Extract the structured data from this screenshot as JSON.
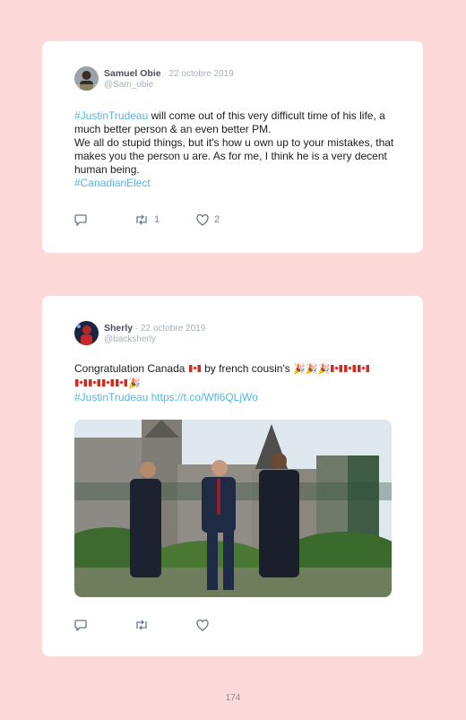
{
  "tweets": [
    {
      "name": "Samuel Obie",
      "date": " · 22 octobre 2019",
      "handle": "@Sam_obie",
      "hashtag1": "#JustinTrudeau",
      "line1_rest": " will come out of this very difficult time of his life, a much better person & an even better PM.",
      "line2": "We all do stupid things, but it's how u own up to your mistakes, that makes you the person u are. As for me, I think he is a very decent human being.",
      "hashtag2": "#CanadianElect",
      "retweets": "1",
      "likes": "2"
    },
    {
      "name": "Sherly",
      "date": " · 22 octobre 2019",
      "handle": "@backsherly",
      "text": "Congratulation Canada",
      "text2": " by french cousin's ",
      "hashtag": "#JustinTrudeau",
      "link": "https://t.co/Wfl6QLjWo"
    }
  ],
  "footer": {
    "page_number": "174"
  }
}
